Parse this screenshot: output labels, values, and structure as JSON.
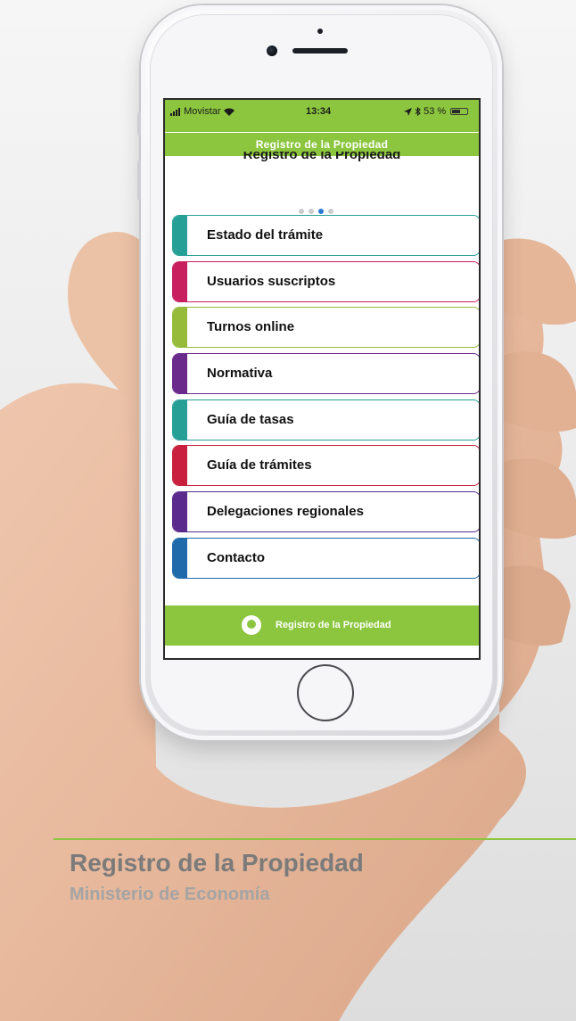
{
  "status_bar": {
    "carrier": "Movistar",
    "time": "13:34",
    "battery_pct": "53 %"
  },
  "app_title": "Registro de la Propiedad",
  "page_heading": "Registro de la Propiedad",
  "pager": {
    "count": 4,
    "active_index": 2
  },
  "menu": {
    "items": [
      {
        "label": "Estado del trámite",
        "color": "#26a096"
      },
      {
        "label": "Usuarios suscriptos",
        "color": "#c8205e"
      },
      {
        "label": "Turnos online",
        "color": "#96bb3b"
      },
      {
        "label": "Normativa",
        "color": "#6a2a8c"
      },
      {
        "label": "Guía de tasas",
        "color": "#26a096"
      },
      {
        "label": "Guía de trámites",
        "color": "#c8203e"
      },
      {
        "label": "Delegaciones regionales",
        "color": "#5a2a8c"
      },
      {
        "label": "Contacto",
        "color": "#1f6aab"
      }
    ]
  },
  "footer": {
    "text": "Registro de la Propiedad"
  },
  "branding": {
    "title": "Registro de la Propiedad",
    "subtitle": "Ministerio de Economía"
  },
  "colors": {
    "accent": "#8cc63f"
  }
}
